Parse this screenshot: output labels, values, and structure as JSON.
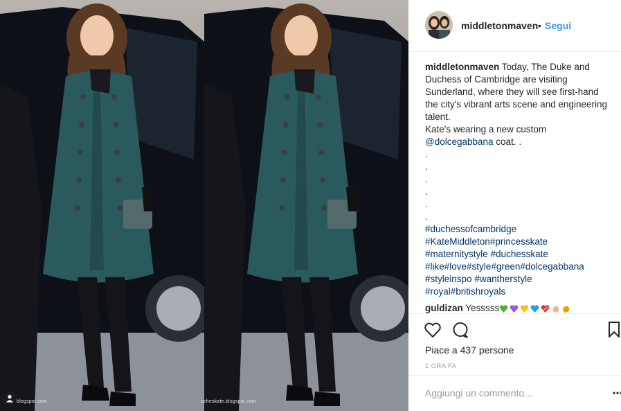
{
  "photo": {
    "credit_left": "blogspot.com",
    "credit_right": "ucheskate.blogspot.com",
    "tag_icon": "person-icon",
    "colors": {
      "coat": "#2b5a5e",
      "car": "#0d1117",
      "ground": "#8a8f96"
    }
  },
  "header": {
    "username": "middletonmaven",
    "separator": "•",
    "follow_label": "Segui"
  },
  "caption": {
    "username": "middletonmaven",
    "text_1": "Today, The Duke and Duchess of Cambridge are visiting Sunderland, where they will see first-hand the city's vibrant arts scene and engineering talent.",
    "text_2": "Kate's wearing a new custom ",
    "mention": "@dolcegabbana",
    "text_3": " coat. .",
    "dot_lines": [
      ".",
      ".",
      ".",
      ".",
      ".",
      "."
    ],
    "hashtag_lines": [
      [
        "#duchessofcambridge"
      ],
      [
        "#KateMiddleton",
        "#princesskate"
      ],
      [
        "#maternitystyle",
        " ",
        "#duchesskate"
      ],
      [
        "#like",
        "#love",
        "#style",
        "#green",
        "#dolcegabbana"
      ],
      [
        "#styleinspo",
        " ",
        "#wantherstyle"
      ],
      [
        "#royal",
        "#britishroyals"
      ]
    ]
  },
  "comment": {
    "username": "guldizan",
    "text": "Yesssss",
    "emojis": [
      "green-heart-icon",
      "purple-heart-icon",
      "yellow-heart-icon",
      "blue-heart-icon",
      "heart-with-ribbon-icon",
      "clapping-hands-icon",
      "clapping-hands-icon"
    ]
  },
  "actions": {
    "likes_label": "Piace a 437 persone",
    "timestamp": "1 ORA FA",
    "comment_placeholder": "Aggiungi un commento...",
    "icons": [
      "heart-icon",
      "comment-icon",
      "bookmark-icon",
      "more-icon"
    ]
  }
}
